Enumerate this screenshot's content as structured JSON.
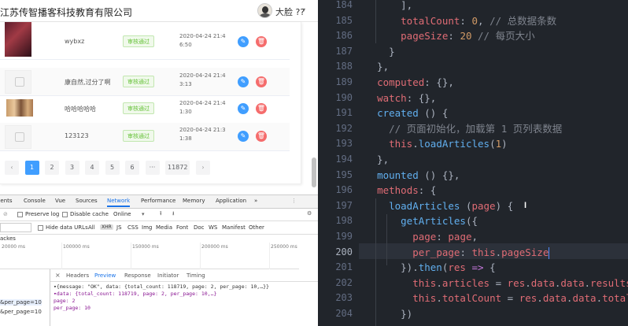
{
  "header": {
    "title": "江苏传智播客科技教育有限公司",
    "user_name": "大脸 ??",
    "caret": "▾"
  },
  "articles": [
    {
      "title": "wybxz",
      "status": "审核通过",
      "date": "2020-04-24 21:46:50",
      "thumb": "photo-red"
    },
    {
      "title": "康自然,过分了啊",
      "status": "审核通过",
      "date": "2020-04-24 21:43:13",
      "thumb": "placeholder"
    },
    {
      "title": "哈哈哈哈哈",
      "status": "审核通过",
      "date": "2020-04-24 21:41:30",
      "thumb": "photo-people"
    },
    {
      "title": "123123",
      "status": "审核通过",
      "date": "2020-04-24 21:31:38",
      "thumb": "placeholder"
    }
  ],
  "row_actions": {
    "edit_icon": "✎",
    "delete_icon": "🗑"
  },
  "pagination": {
    "prev": "‹",
    "pages": [
      "1",
      "2",
      "3",
      "4",
      "5",
      "6",
      "···",
      "11872"
    ],
    "next": "›",
    "current": "1"
  },
  "devtools": {
    "tabs": [
      "nents",
      "Console",
      "Vue",
      "Sources",
      "Network",
      "Performance",
      "Memory",
      "Application",
      "»"
    ],
    "active_tab": "Network",
    "toolbar": {
      "preserve_log": "Preserve log",
      "disable_cache": "Disable cache",
      "throttle": "Online"
    },
    "filter": {
      "hide_data_urls": "Hide data URLs",
      "types": [
        "All",
        "XHR",
        "JS",
        "CSS",
        "Img",
        "Media",
        "Font",
        "Doc",
        "WS",
        "Manifest",
        "Other"
      ],
      "active_type": "XHR"
    },
    "blocked_label": "ackes",
    "timeline_labels": [
      "20000 ms",
      "100000 ms",
      "150000 ms",
      "200000 ms",
      "250000 ms"
    ],
    "requests": [
      "&per_page=10",
      "&per_page=10"
    ],
    "detail_tabs": [
      "Headers",
      "Preview",
      "Response",
      "Initiator",
      "Timing"
    ],
    "active_detail_tab": "Preview",
    "close": "×",
    "preview_lines": [
      "▾{message: \"OK\", data: {total_count: 118719, page: 2, per_page: 10,…}}",
      "  ▾data: {total_count: 118719, page: 2, per_page: 10,…}",
      "      page: 2",
      "      per_page: 10"
    ]
  },
  "editor": {
    "line_numbers": [
      "184",
      "185",
      "186",
      "187",
      "188",
      "189",
      "190",
      "191",
      "192",
      "193",
      "194",
      "195",
      "196",
      "197",
      "198",
      "199",
      "200",
      "201",
      "202",
      "203",
      "204"
    ],
    "current_line": "200"
  }
}
